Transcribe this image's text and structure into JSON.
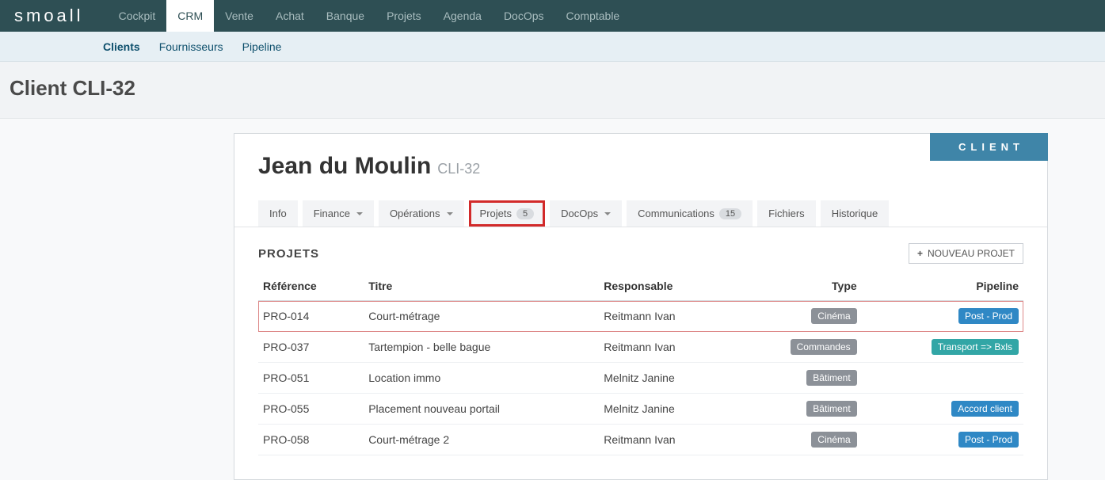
{
  "logo": "smoall",
  "topnav": [
    "Cockpit",
    "CRM",
    "Vente",
    "Achat",
    "Banque",
    "Projets",
    "Agenda",
    "DocOps",
    "Comptable"
  ],
  "topnav_active": 1,
  "subnav": [
    "Clients",
    "Fournisseurs",
    "Pipeline"
  ],
  "subnav_active": 0,
  "page_title": "Client CLI-32",
  "client_badge": "CLIENT",
  "client_name": "Jean du Moulin",
  "client_code": "CLI-32",
  "tabs": [
    {
      "label": "Info"
    },
    {
      "label": "Finance",
      "dropdown": true
    },
    {
      "label": "Opérations",
      "dropdown": true
    },
    {
      "label": "Projets",
      "count": "5",
      "highlight": true
    },
    {
      "label": "DocOps",
      "dropdown": true
    },
    {
      "label": "Communications",
      "count": "15"
    },
    {
      "label": "Fichiers"
    },
    {
      "label": "Historique"
    }
  ],
  "section_title": "PROJETS",
  "new_project_btn": "NOUVEAU PROJET",
  "columns": {
    "ref": "Référence",
    "title": "Titre",
    "resp": "Responsable",
    "type": "Type",
    "pipeline": "Pipeline"
  },
  "rows": [
    {
      "ref": "PRO-014",
      "title": "Court-métrage",
      "resp": "Reitmann Ivan",
      "type": "Cinéma",
      "type_class": "grey",
      "pipeline": "Post - Prod",
      "pipeline_class": "blue",
      "highlight": true
    },
    {
      "ref": "PRO-037",
      "title": "Tartempion - belle bague",
      "resp": "Reitmann Ivan",
      "type": "Commandes",
      "type_class": "grey",
      "pipeline": "Transport => Bxls",
      "pipeline_class": "teal"
    },
    {
      "ref": "PRO-051",
      "title": "Location immo",
      "resp": "Melnitz Janine",
      "type": "Bâtiment",
      "type_class": "grey",
      "pipeline": "",
      "pipeline_class": ""
    },
    {
      "ref": "PRO-055",
      "title": "Placement nouveau portail",
      "resp": "Melnitz Janine",
      "type": "Bâtiment",
      "type_class": "grey",
      "pipeline": "Accord client",
      "pipeline_class": "blue"
    },
    {
      "ref": "PRO-058",
      "title": "Court-métrage 2",
      "resp": "Reitmann Ivan",
      "type": "Cinéma",
      "type_class": "grey",
      "pipeline": "Post - Prod",
      "pipeline_class": "blue"
    }
  ]
}
